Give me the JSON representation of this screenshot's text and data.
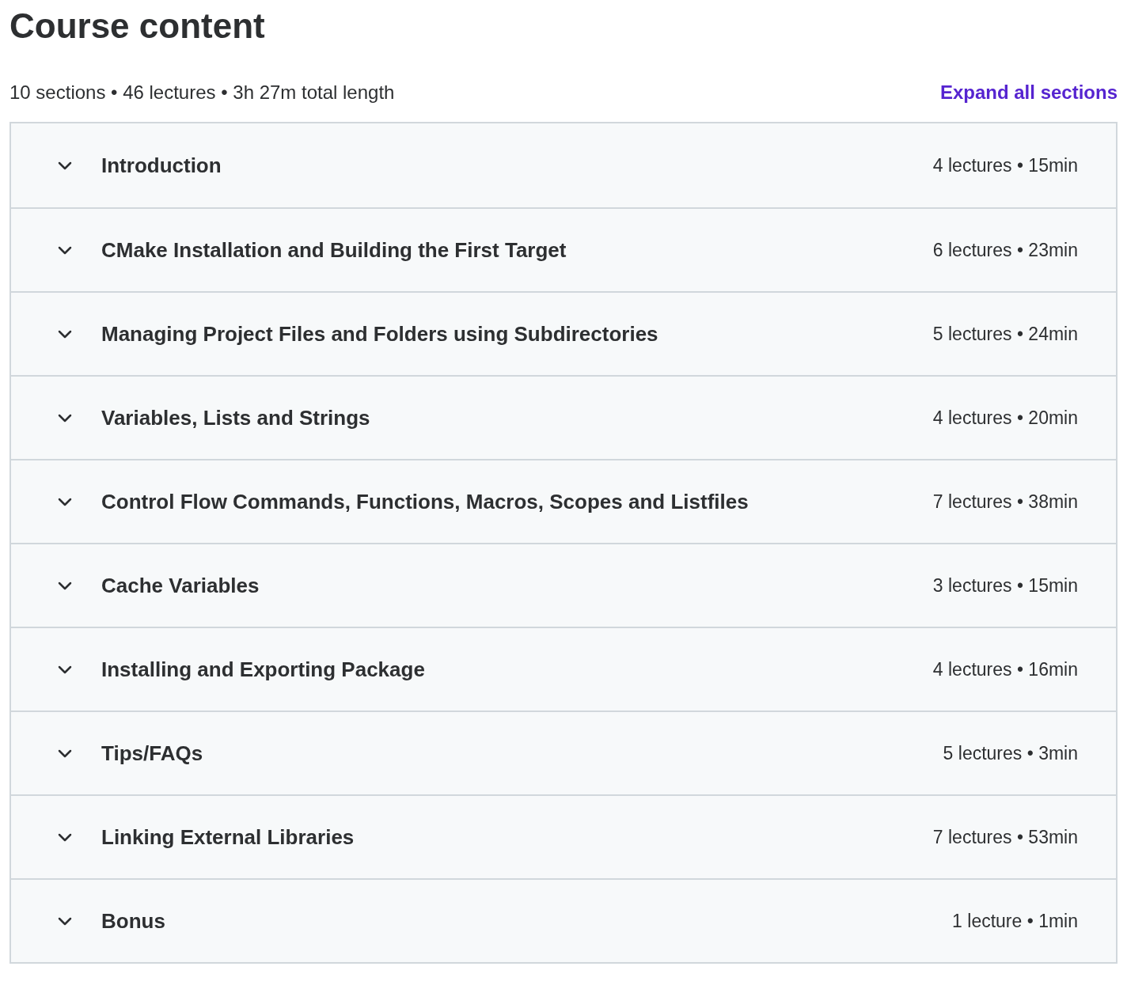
{
  "heading": "Course content",
  "summary": "10 sections • 46 lectures • 3h 27m total length",
  "expand_link": "Expand all sections",
  "sections": [
    {
      "title": "Introduction",
      "meta": "4 lectures • 15min",
      "expanded": false
    },
    {
      "title": "CMake Installation and Building the First Target",
      "meta": "6 lectures • 23min",
      "expanded": false
    },
    {
      "title": "Managing Project Files and Folders using Subdirectories",
      "meta": "5 lectures • 24min",
      "expanded": false
    },
    {
      "title": "Variables, Lists and Strings",
      "meta": "4 lectures • 20min",
      "expanded": false
    },
    {
      "title": "Control Flow Commands, Functions, Macros, Scopes and Listfiles",
      "meta": "7 lectures • 38min",
      "expanded": false
    },
    {
      "title": "Cache Variables",
      "meta": "3 lectures • 15min",
      "expanded": false
    },
    {
      "title": "Installing and Exporting Package",
      "meta": "4 lectures • 16min",
      "expanded": false
    },
    {
      "title": "Tips/FAQs",
      "meta": "5 lectures • 3min",
      "expanded": false
    },
    {
      "title": "Linking External Libraries",
      "meta": "7 lectures • 53min",
      "expanded": false
    },
    {
      "title": "Bonus",
      "meta": "1 lecture • 1min",
      "expanded": false
    }
  ]
}
